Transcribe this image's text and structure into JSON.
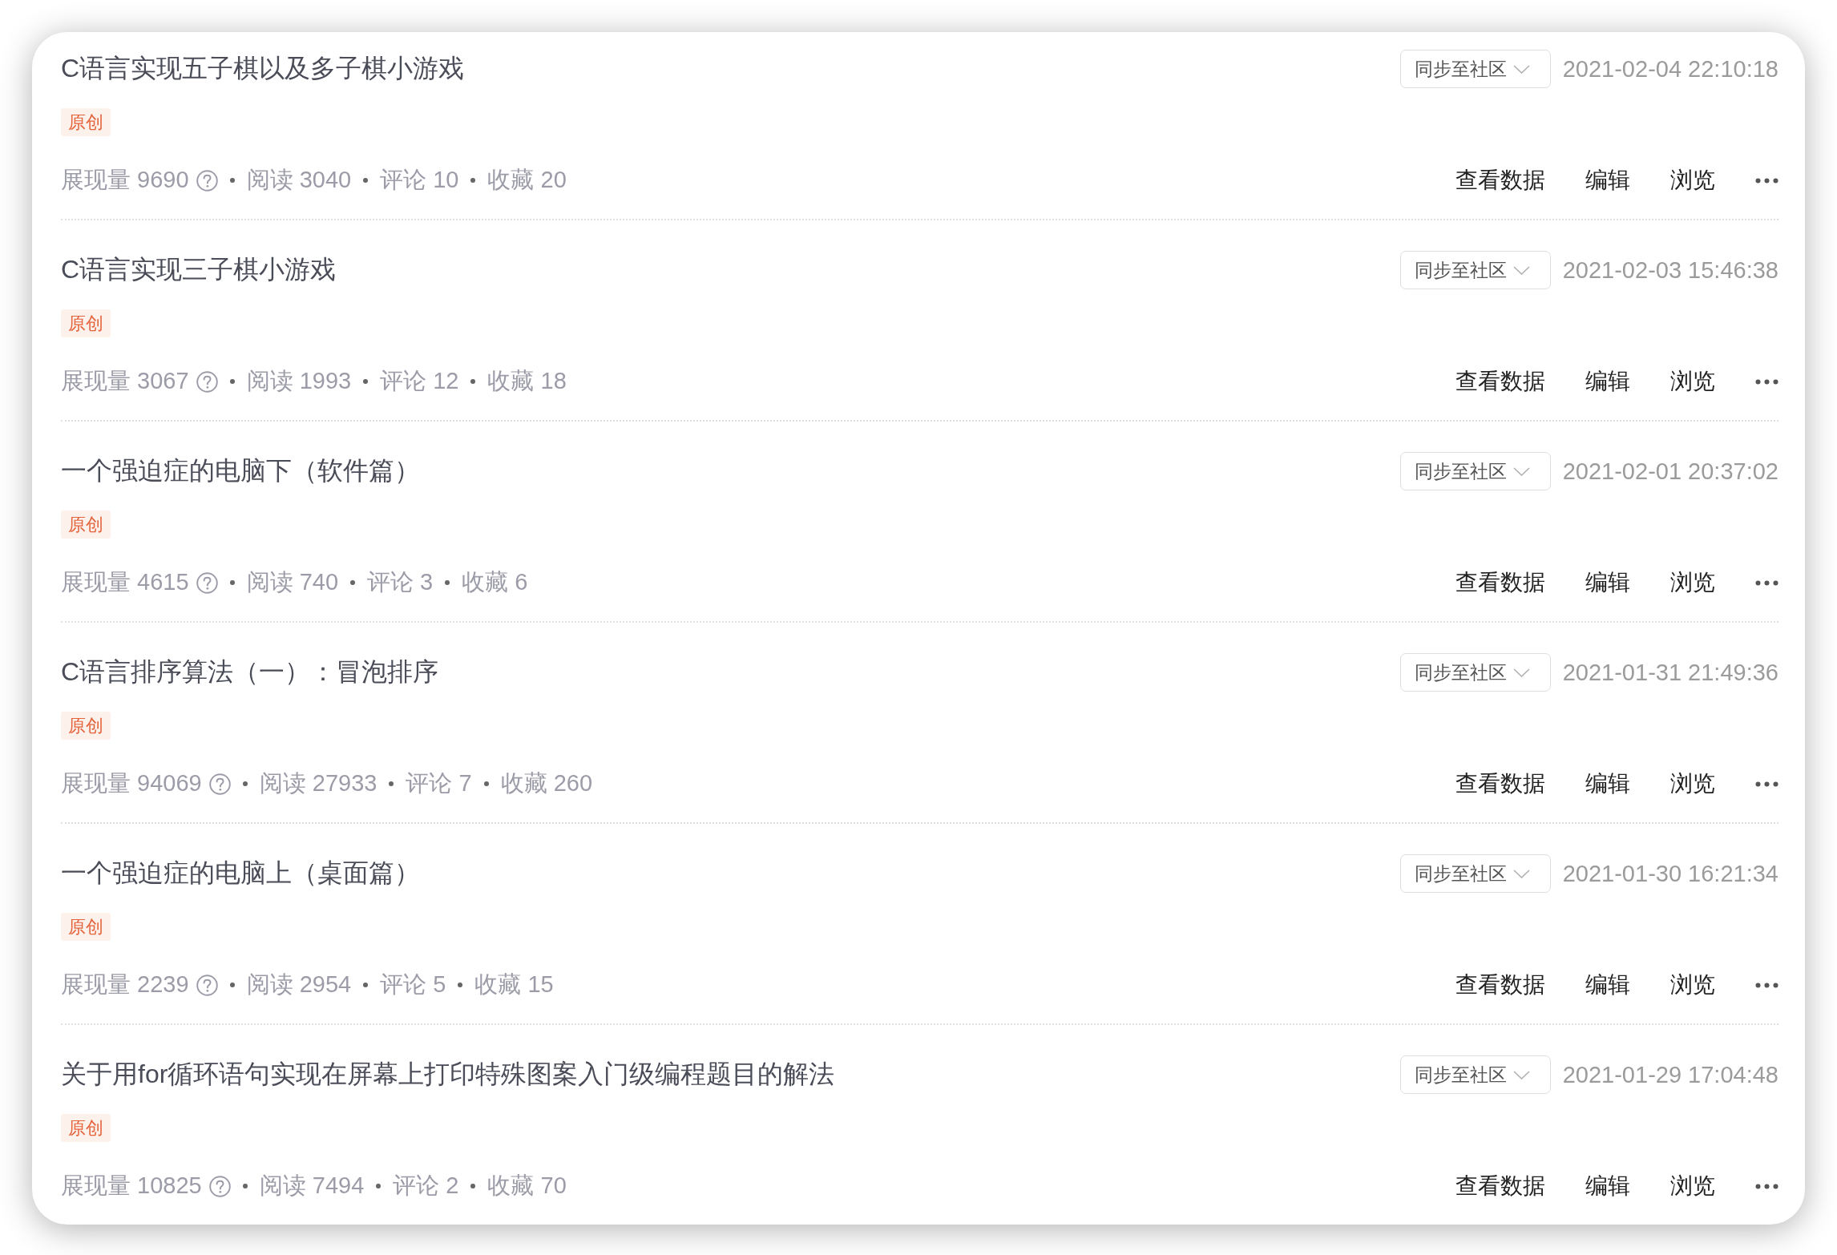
{
  "articles": [
    {
      "title": "C语言实现五子棋以及多子棋小游戏",
      "tag": "原创",
      "sync_dropdown": "同步至社区",
      "date": "2021-02-04 22:10:18",
      "stats": [
        {
          "text": "展现量 9690",
          "help": true
        },
        {
          "text": "阅读 3040",
          "help": false
        },
        {
          "text": "评论 10",
          "help": false
        },
        {
          "text": "收藏 20",
          "help": false
        }
      ],
      "actions": [
        "查看数据",
        "编辑",
        "浏览"
      ]
    },
    {
      "title": "C语言实现三子棋小游戏",
      "tag": "原创",
      "sync_dropdown": "同步至社区",
      "date": "2021-02-03 15:46:38",
      "stats": [
        {
          "text": "展现量 3067",
          "help": true
        },
        {
          "text": "阅读 1993",
          "help": false
        },
        {
          "text": "评论 12",
          "help": false
        },
        {
          "text": "收藏 18",
          "help": false
        }
      ],
      "actions": [
        "查看数据",
        "编辑",
        "浏览"
      ]
    },
    {
      "title": "一个强迫症的电脑下（软件篇）",
      "tag": "原创",
      "sync_dropdown": "同步至社区",
      "date": "2021-02-01 20:37:02",
      "stats": [
        {
          "text": "展现量 4615",
          "help": true
        },
        {
          "text": "阅读 740",
          "help": false
        },
        {
          "text": "评论 3",
          "help": false
        },
        {
          "text": "收藏 6",
          "help": false
        }
      ],
      "actions": [
        "查看数据",
        "编辑",
        "浏览"
      ]
    },
    {
      "title": "C语言排序算法（一）：冒泡排序",
      "tag": "原创",
      "sync_dropdown": "同步至社区",
      "date": "2021-01-31 21:49:36",
      "stats": [
        {
          "text": "展现量 94069",
          "help": true
        },
        {
          "text": "阅读 27933",
          "help": false
        },
        {
          "text": "评论 7",
          "help": false
        },
        {
          "text": "收藏 260",
          "help": false
        }
      ],
      "actions": [
        "查看数据",
        "编辑",
        "浏览"
      ]
    },
    {
      "title": "一个强迫症的电脑上（桌面篇）",
      "tag": "原创",
      "sync_dropdown": "同步至社区",
      "date": "2021-01-30 16:21:34",
      "stats": [
        {
          "text": "展现量 2239",
          "help": true
        },
        {
          "text": "阅读 2954",
          "help": false
        },
        {
          "text": "评论 5",
          "help": false
        },
        {
          "text": "收藏 15",
          "help": false
        }
      ],
      "actions": [
        "查看数据",
        "编辑",
        "浏览"
      ]
    },
    {
      "title": "关于用for循环语句实现在屏幕上打印特殊图案入门级编程题目的解法",
      "tag": "原创",
      "sync_dropdown": "同步至社区",
      "date": "2021-01-29 17:04:48",
      "stats": [
        {
          "text": "展现量 10825",
          "help": true
        },
        {
          "text": "阅读 7494",
          "help": false
        },
        {
          "text": "评论 2",
          "help": false
        },
        {
          "text": "收藏 70",
          "help": false
        }
      ],
      "actions": [
        "查看数据",
        "编辑",
        "浏览"
      ]
    }
  ]
}
